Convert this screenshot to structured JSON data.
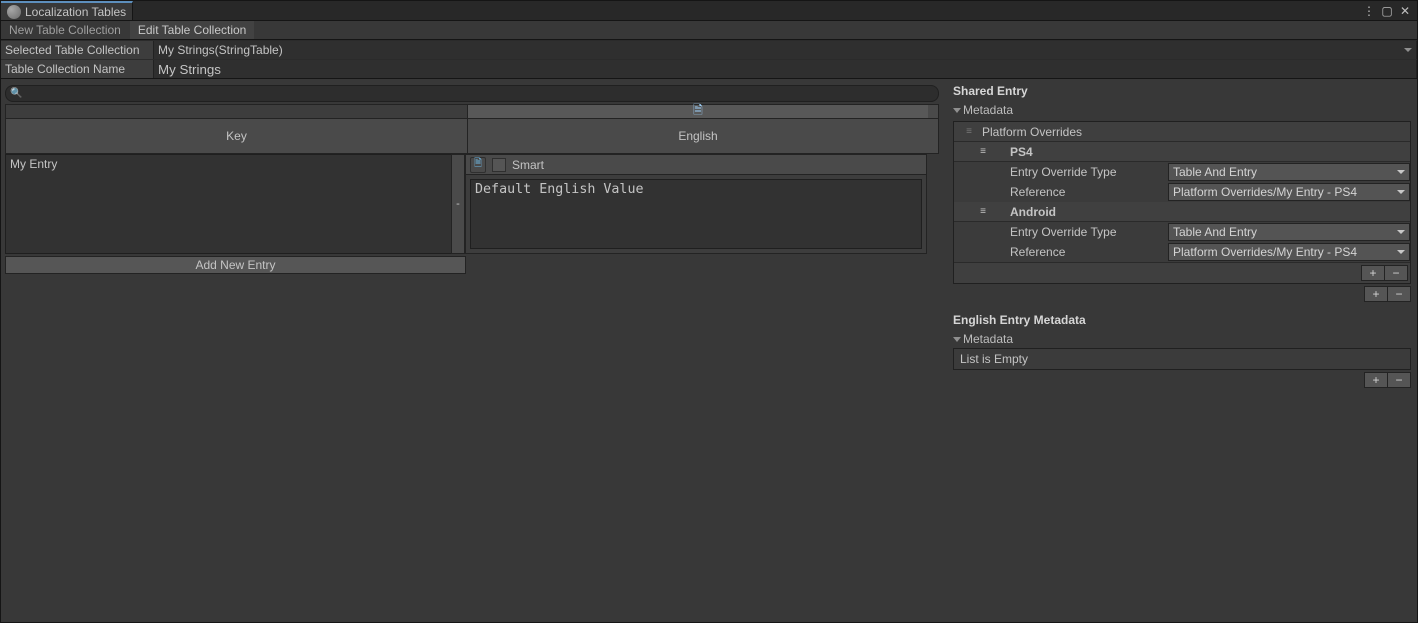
{
  "window": {
    "title": "Localization Tables"
  },
  "sub_tabs": [
    {
      "label": "New Table Collection",
      "dim": true
    },
    {
      "label": "Edit Table Collection",
      "dim": false
    }
  ],
  "fields": {
    "selected_label": "Selected Table Collection",
    "selected_value": "My Strings(StringTable)",
    "name_label": "Table Collection Name",
    "name_value": "My Strings"
  },
  "search": {
    "placeholder": ""
  },
  "grid": {
    "columns": {
      "key": "Key",
      "lang": "English"
    },
    "entry": {
      "key": "My Entry",
      "value": "Default English Value"
    },
    "smart_label": "Smart",
    "remove_label": "-",
    "add_label": "Add New Entry"
  },
  "right": {
    "shared_title": "Shared Entry",
    "metadata_label": "Metadata",
    "po_title": "Platform Overrides",
    "platforms": [
      {
        "name": "PS4",
        "fields": [
          {
            "label": "Entry Override Type",
            "value": "Table And Entry"
          },
          {
            "label": "Reference",
            "value": "Platform Overrides/My Entry - PS4"
          }
        ]
      },
      {
        "name": "Android",
        "fields": [
          {
            "label": "Entry Override Type",
            "value": "Table And Entry"
          },
          {
            "label": "Reference",
            "value": "Platform Overrides/My Entry - PS4"
          }
        ]
      }
    ],
    "english_title": "English Entry Metadata",
    "empty_label": "List is Empty",
    "plus_label": "+",
    "minus_label": "−"
  }
}
